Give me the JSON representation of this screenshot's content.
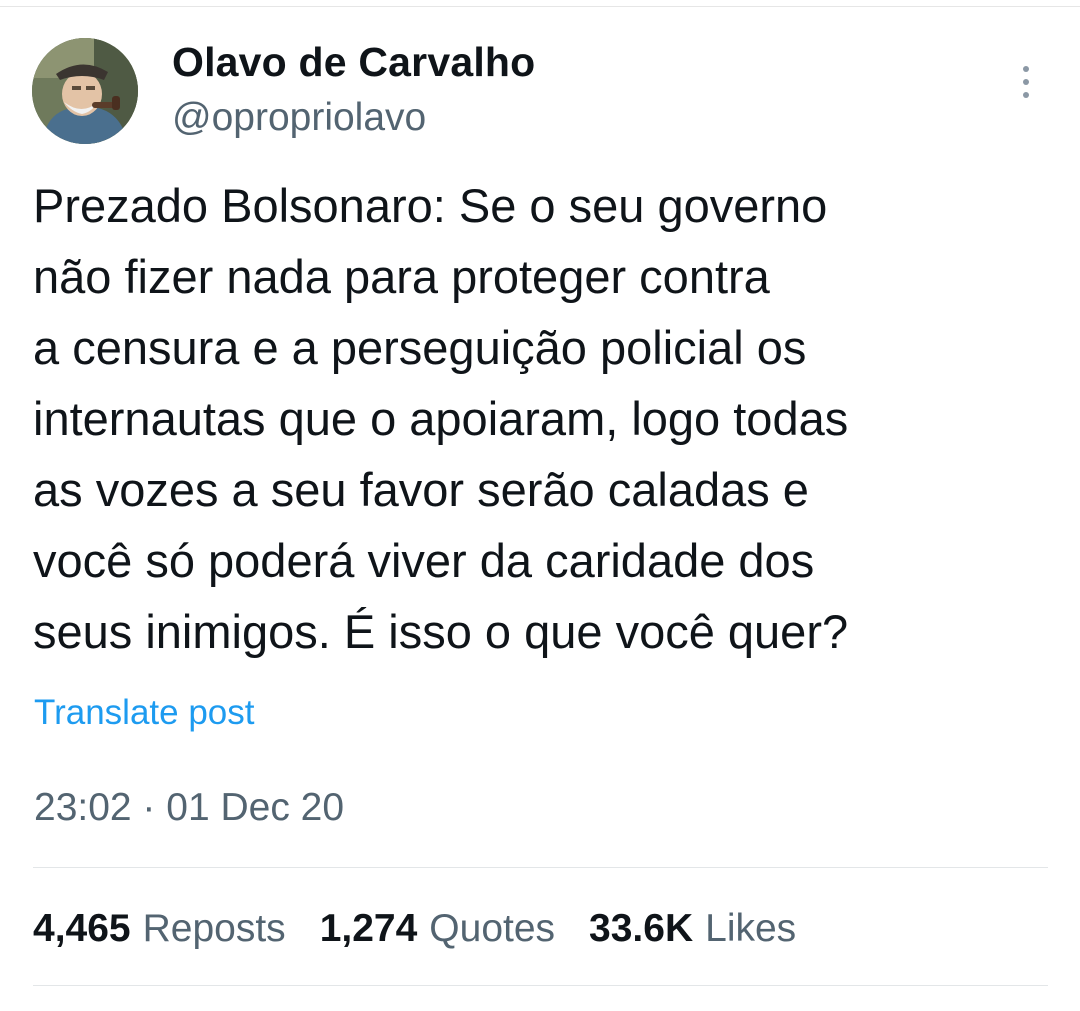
{
  "author": {
    "display_name": "Olavo de Carvalho",
    "handle": "@opropriolavo",
    "avatar_icon": "profile-photo"
  },
  "post": {
    "text": "Prezado Bolsonaro: Se o seu governo\nnão fizer nada para proteger contra\na censura e a perseguição policial os\ninternautas que o apoiaram, logo todas\nas vozes a seu favor serão caladas e\nvocê só poderá viver da caridade dos\nseus inimigos. É isso o que você quer?",
    "translate_label": "Translate post",
    "timestamp": "23:02 · 01 Dec 20"
  },
  "stats": {
    "reposts_count": "4,465",
    "reposts_label": "Reposts",
    "quotes_count": "1,274",
    "quotes_label": "Quotes",
    "likes_count": "33.6K",
    "likes_label": "Likes"
  },
  "colors": {
    "text_primary": "#0f1419",
    "text_secondary": "#536471",
    "link": "#1d9bf0",
    "divider": "#e3e6e8"
  }
}
